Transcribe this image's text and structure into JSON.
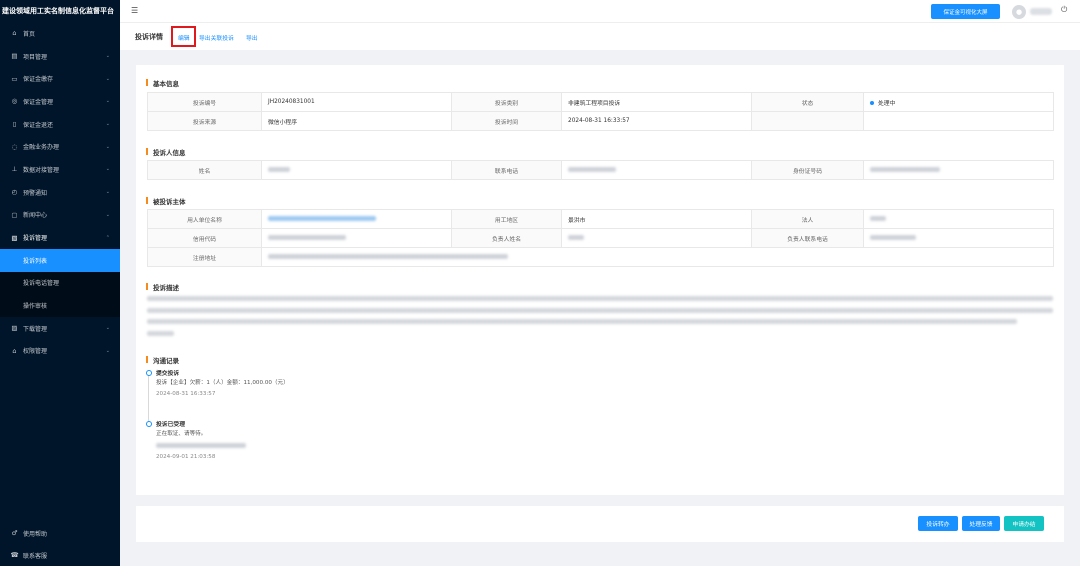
{
  "sidebar": {
    "brand": "建设领域用工实名制信息化监督平台",
    "items": [
      {
        "label": "首页",
        "icon": "⌂"
      },
      {
        "label": "项目管理",
        "icon": "▤"
      },
      {
        "label": "保证金缴存",
        "icon": "▭"
      },
      {
        "label": "保证金管理",
        "icon": "◎"
      },
      {
        "label": "保证金退还",
        "icon": "▯"
      },
      {
        "label": "金融业务办理",
        "icon": "◌"
      },
      {
        "label": "数据对接管理",
        "icon": "⊥"
      },
      {
        "label": "预警通知",
        "icon": "◴"
      },
      {
        "label": "新闻中心",
        "icon": "▢"
      },
      {
        "label": "投诉管理",
        "icon": "▧"
      }
    ],
    "submenu": [
      {
        "label": "投诉列表"
      },
      {
        "label": "投诉电话管理"
      },
      {
        "label": "操作审核"
      }
    ],
    "items_after": [
      {
        "label": "下载管理",
        "icon": "▨"
      },
      {
        "label": "权限管理",
        "icon": "⌂"
      }
    ],
    "bottom": [
      {
        "label": "使用帮助",
        "icon": "♂"
      },
      {
        "label": "联系客服",
        "icon": "☎"
      }
    ]
  },
  "header": {
    "big_screen_label": "保证金可视化大屏"
  },
  "crumb": {
    "title": "投诉详情",
    "edit_label": "编辑",
    "export_related_label": "导出关联投诉",
    "export_label": "导出"
  },
  "basic": {
    "title": "基本信息",
    "complaint_no_label": "投诉编号",
    "complaint_no": "JH20240831001",
    "category_label": "投诉类别",
    "category": "非建筑工程项目投诉",
    "status_label": "状态",
    "status": "处理中",
    "source_label": "投诉来源",
    "source": "微信小程序",
    "time_label": "投诉时间",
    "time": "2024-08-31 16:33:57"
  },
  "complainant": {
    "title": "投诉人信息",
    "name_label": "姓名",
    "phone_label": "联系电话",
    "id_label": "身份证号码"
  },
  "respondent": {
    "title": "被投诉主体",
    "employer_label": "用人单位名称",
    "region_label": "用工地区",
    "region": "景洪市",
    "legal_label": "法人",
    "credit_label": "信用代码",
    "manager_label": "负责人姓名",
    "manager_phone_label": "负责人联系电话",
    "address_label": "注册地址"
  },
  "description": {
    "title": "投诉描述"
  },
  "communication": {
    "title": "沟通记录",
    "records": [
      {
        "title": "提交投诉",
        "text": "投诉【企业】欠薪：1（人）金额：11,000.00（元）",
        "time": "2024-08-31 16:33:57"
      },
      {
        "title": "投诉已受理",
        "text": "正在取证、请等待。",
        "time": "2024-09-01 21:03:58"
      }
    ]
  },
  "actions": {
    "transfer_label": "投诉转办",
    "feedback_label": "处理反馈",
    "close_label": "申请办结"
  },
  "colors": {
    "primary": "#1890ff",
    "success": "#13c2c2",
    "sidebar_bg": "#001529",
    "accent_bar": "#f58a1f",
    "highlight_box": "#e0191e"
  }
}
